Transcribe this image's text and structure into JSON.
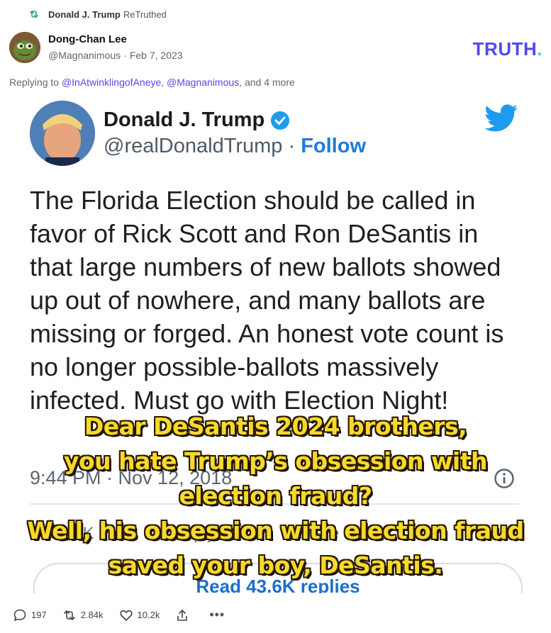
{
  "retruth": {
    "icon": "retruth-icon",
    "name": "Donald J. Trump",
    "label": "ReTruthed"
  },
  "post": {
    "author_name": "Dong-Chan Lee",
    "handle": "@Magnanimous",
    "date": "Feb 7, 2023",
    "replying_prefix": "Replying to",
    "mentions": [
      "@InAtwinklingofAneye",
      "@Magnanimous"
    ],
    "more_text": "and 4 more"
  },
  "logo": {
    "text": "TRUTH",
    "dot": "."
  },
  "embedded_tweet": {
    "name": "Donald J. Trump",
    "handle": "@realDonaldTrump",
    "follow": "Follow",
    "text": "The Florida Election should be called in favor of Rick Scott and Ron DeSantis in that large numbers of new ballots showed up out of nowhere, and many ballots are missing or forged. An honest vote count is no longer possible-ballots massively infected. Must go with Election Night!",
    "timestamp": "9:44 PM · Nov 12, 2018",
    "read_replies": "Read 43.6K replies",
    "actions": [
      "93.7K",
      "Reply",
      "Share"
    ]
  },
  "overlay_caption": {
    "lines": [
      "Dear DeSantis 2024 brothers,",
      "you hate Trump’s obsession with",
      "election fraud?",
      "Well, his obsession with election fraud",
      "saved your boy, DeSantis."
    ]
  },
  "actions": {
    "replies": "197",
    "retruths": "2.84k",
    "likes": "10.2k"
  },
  "colors": {
    "brand": "#5448ee",
    "accent": "#3ed6c0",
    "caption": "#f7d92c",
    "twitter_blue": "#1d9bf0"
  }
}
